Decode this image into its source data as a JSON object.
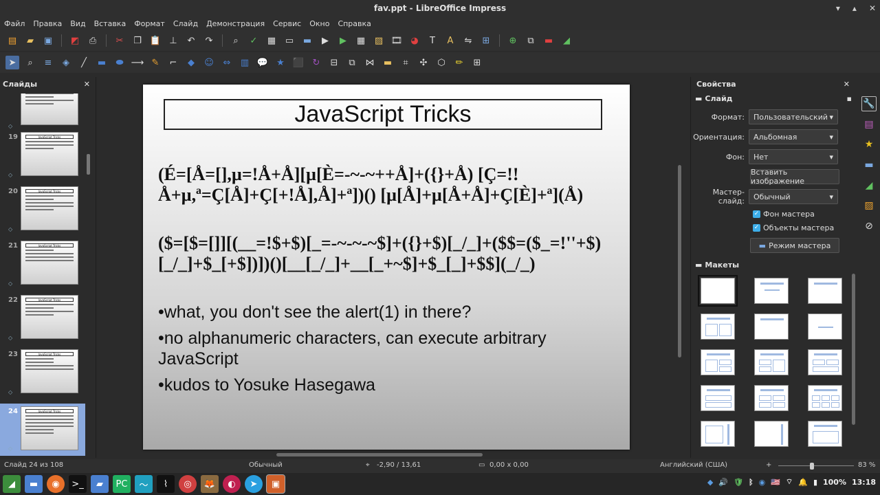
{
  "window": {
    "title": "fav.ppt - LibreOffice Impress"
  },
  "menu": [
    "Файл",
    "Правка",
    "Вид",
    "Вставка",
    "Формат",
    "Слайд",
    "Демонстрация",
    "Сервис",
    "Окно",
    "Справка"
  ],
  "slides_panel": {
    "title": "Слайды",
    "thumbs": [
      {
        "num": "",
        "title": ""
      },
      {
        "num": "19",
        "title": "JavaScript Tricks"
      },
      {
        "num": "20",
        "title": "JavaScript Tricks"
      },
      {
        "num": "21",
        "title": "JavaScript Tricks"
      },
      {
        "num": "22",
        "title": "JavaScript Tricks"
      },
      {
        "num": "23",
        "title": "JavaScript Tricks"
      },
      {
        "num": "24",
        "title": "JavaScript Tricks"
      }
    ]
  },
  "slide": {
    "title": "JavaScript Tricks",
    "code1": "(É=[Å=[],µ=!Å+Å][µ[È=-~-~++Å]+({}+Å) [Ç=!!Å+µ,ª=Ç[Å]+Ç[+!Å],Å]+ª])() [µ[Å]+µ[Å+Å]+Ç[È]+ª](Å)",
    "code2": "($=[$=[]][(__=!$+$)[_=-~-~-~$]+({}+$)[_/_]+($$=($_=!''+$)[_/_]+$_[+$])])()[__[_/_]+__[_+~$]+$_[_]+$$](_/_)",
    "bullets": [
      "•what, you don't see the alert(1) in there?",
      "•no alphanumeric characters, can execute arbitrary JavaScript",
      "•kudos to Yosuke Hasegawa"
    ]
  },
  "properties": {
    "title": "Свойства",
    "section_slide": "Слайд",
    "format_label": "Формат:",
    "format_value": "Пользовательский",
    "orientation_label": "Ориентация:",
    "orientation_value": "Альбомная",
    "background_label": "Фон:",
    "background_value": "Нет",
    "insert_image": "Вставить изображение",
    "master_label": "Мастер-слайд:",
    "master_value": "Обычный",
    "chk_master_bg": "Фон мастера",
    "chk_master_objects": "Объекты мастера",
    "master_mode": "Режим мастера",
    "section_layouts": "Макеты"
  },
  "status": {
    "slide_count": "Слайд 24 из 108",
    "master": "Обычный",
    "position": "-2,90 / 13,61",
    "size": "0,00 x 0,00",
    "language": "Английский (США)",
    "zoom": "83 %"
  },
  "tray": {
    "battery": "100%",
    "time": "13:18"
  }
}
